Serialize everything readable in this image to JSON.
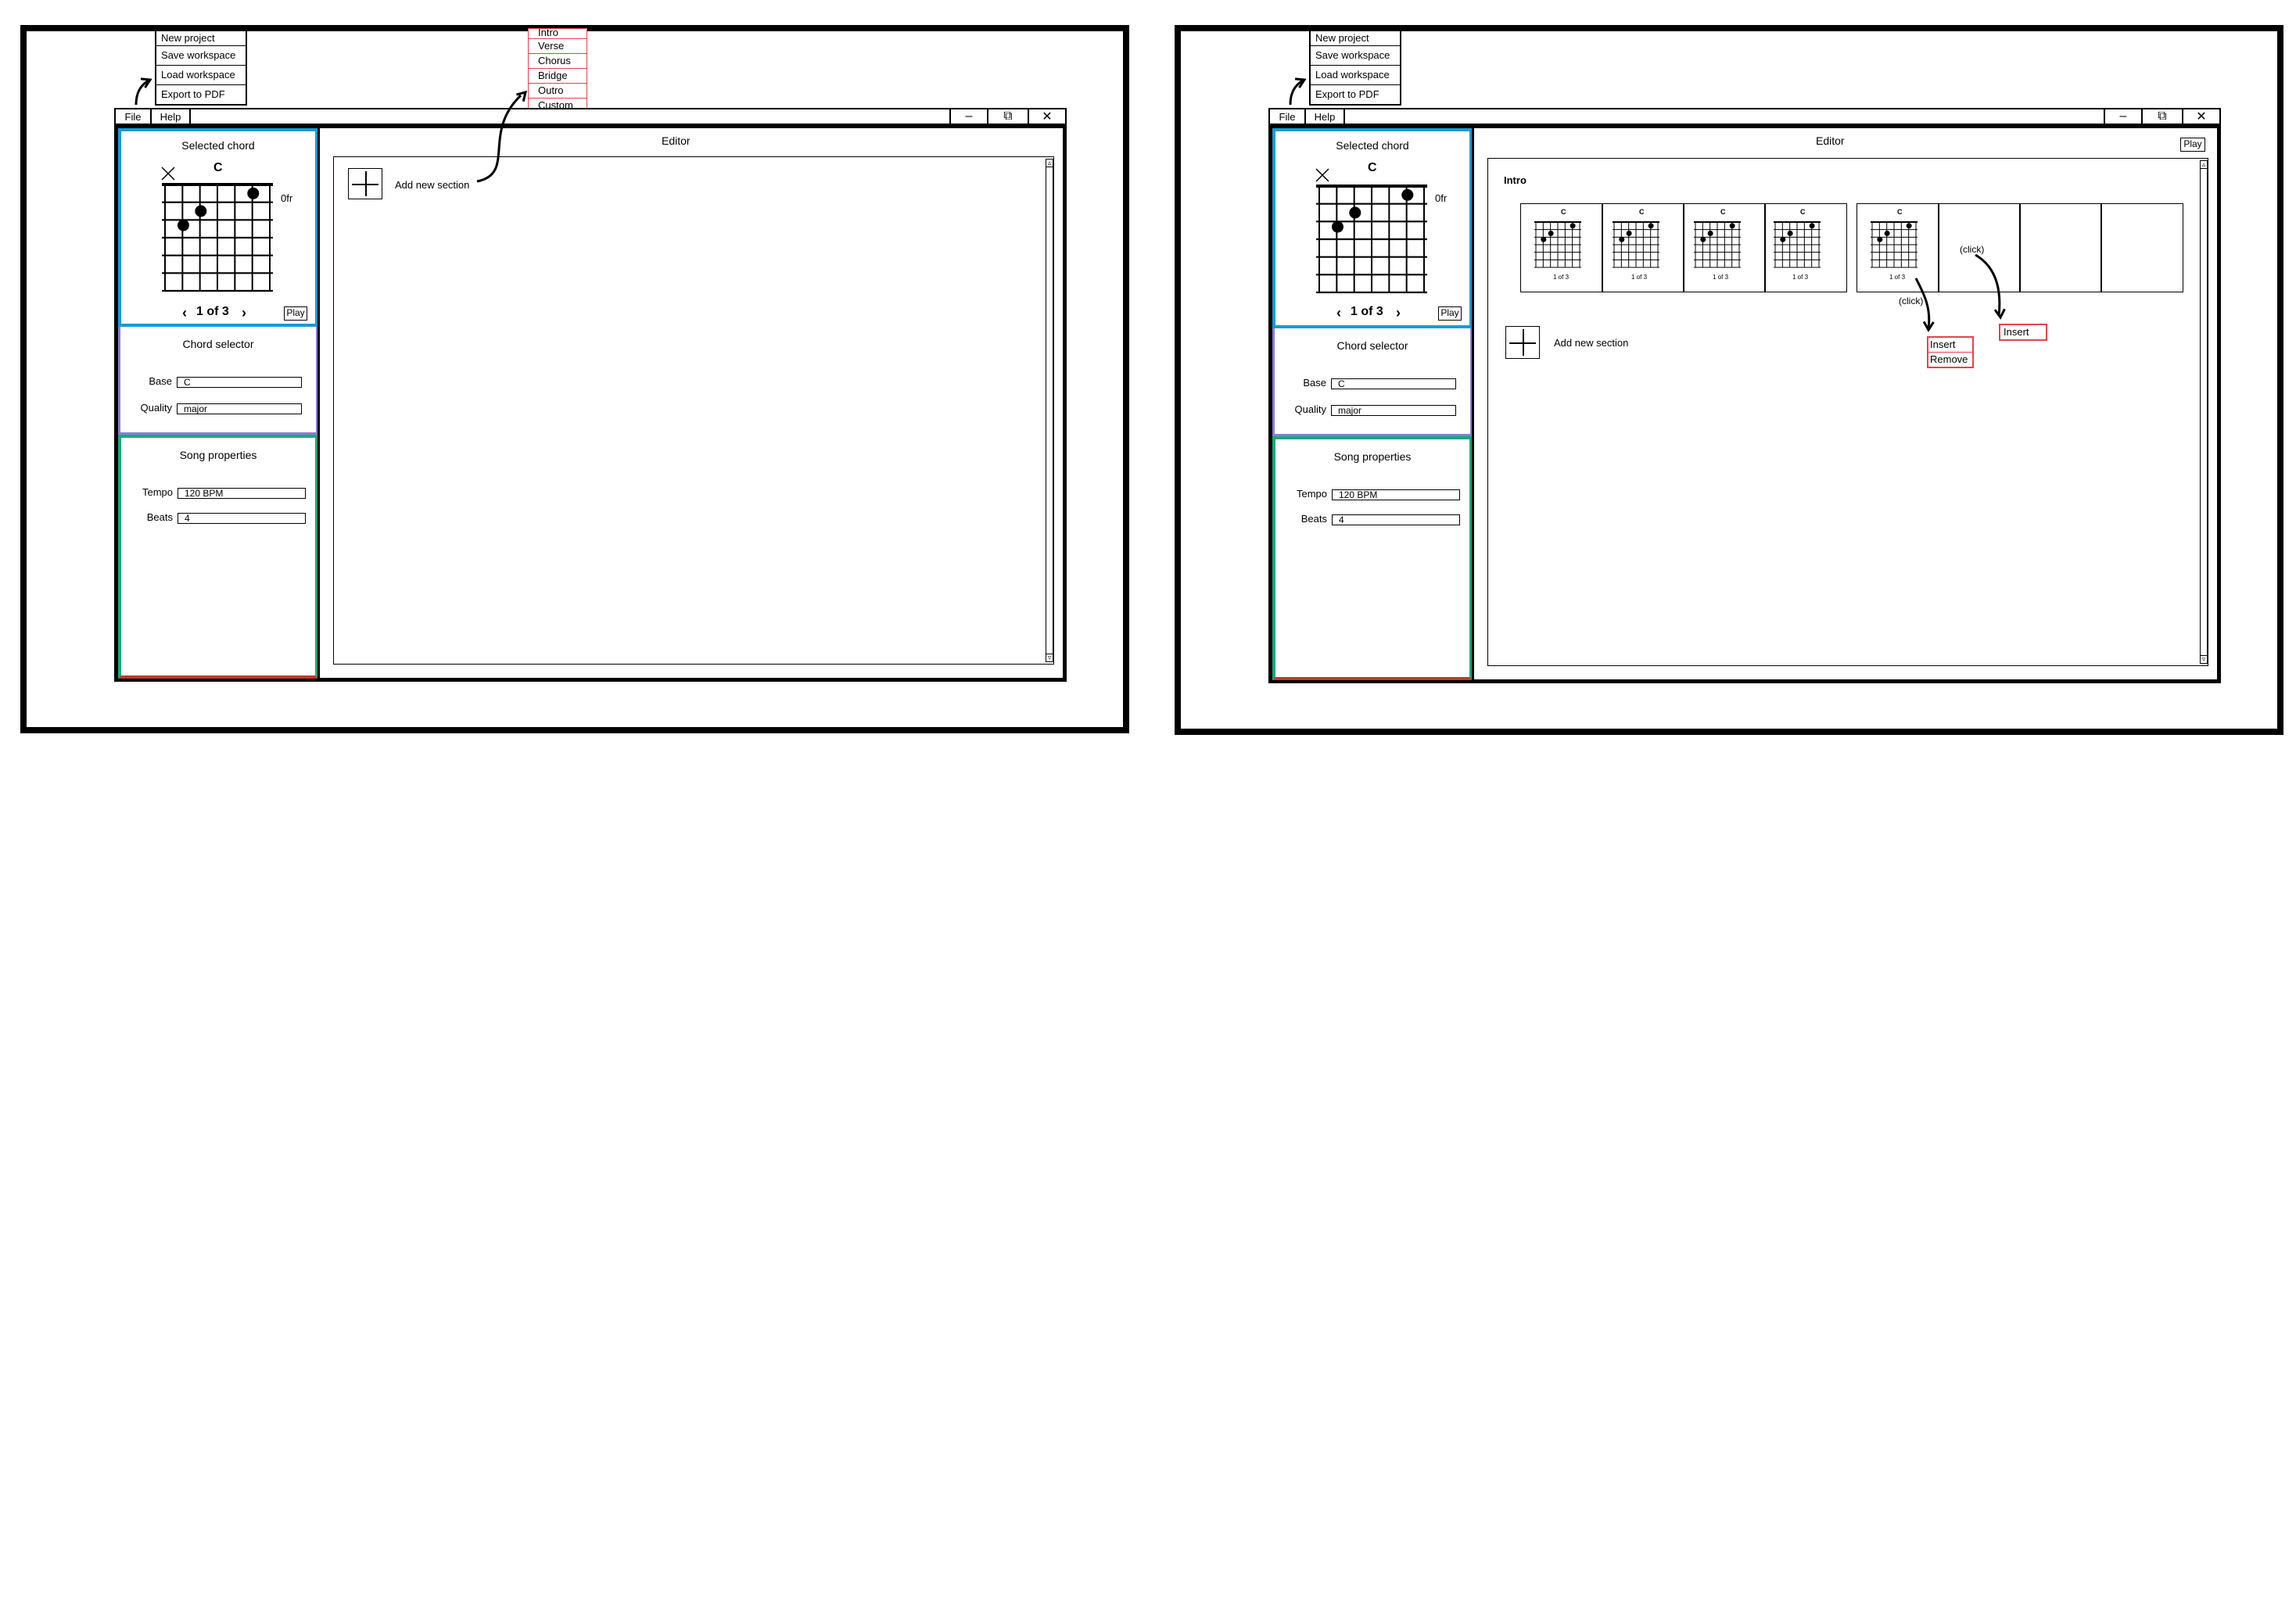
{
  "menubar": {
    "file": "File",
    "help": "Help"
  },
  "file_menu": [
    "New project",
    "Save workspace",
    "Load workspace",
    "Export to PDF"
  ],
  "section_menu": [
    "Intro",
    "Verse",
    "Chorus",
    "Bridge",
    "Outro",
    "Custom"
  ],
  "selected_chord": {
    "title": "Selected chord",
    "chord_name": "C",
    "fret_label": "0fr",
    "voicing": "1 of 3",
    "play": "Play"
  },
  "chord_selector": {
    "title": "Chord selector",
    "base_label": "Base",
    "base_value": "C",
    "quality_label": "Quality",
    "quality_value": "major"
  },
  "song_properties": {
    "title": "Song properties",
    "tempo_label": "Tempo",
    "tempo_value": "120 BPM",
    "beats_label": "Beats",
    "beats_value": "4"
  },
  "editor": {
    "title": "Editor",
    "add_section": "Add new section",
    "play": "Play",
    "section_name": "Intro",
    "mini_chord": {
      "name": "C",
      "voicing": "1 of 3"
    },
    "click_note": "(click)",
    "context_menu": [
      "Insert",
      "Remove"
    ],
    "insert_label": "Insert"
  },
  "colors": {
    "selected_chord": "#1a9ad6",
    "chord_selector": "#8a7cd6",
    "song_properties": "#1aa87a",
    "annotation": "#e0444e"
  }
}
